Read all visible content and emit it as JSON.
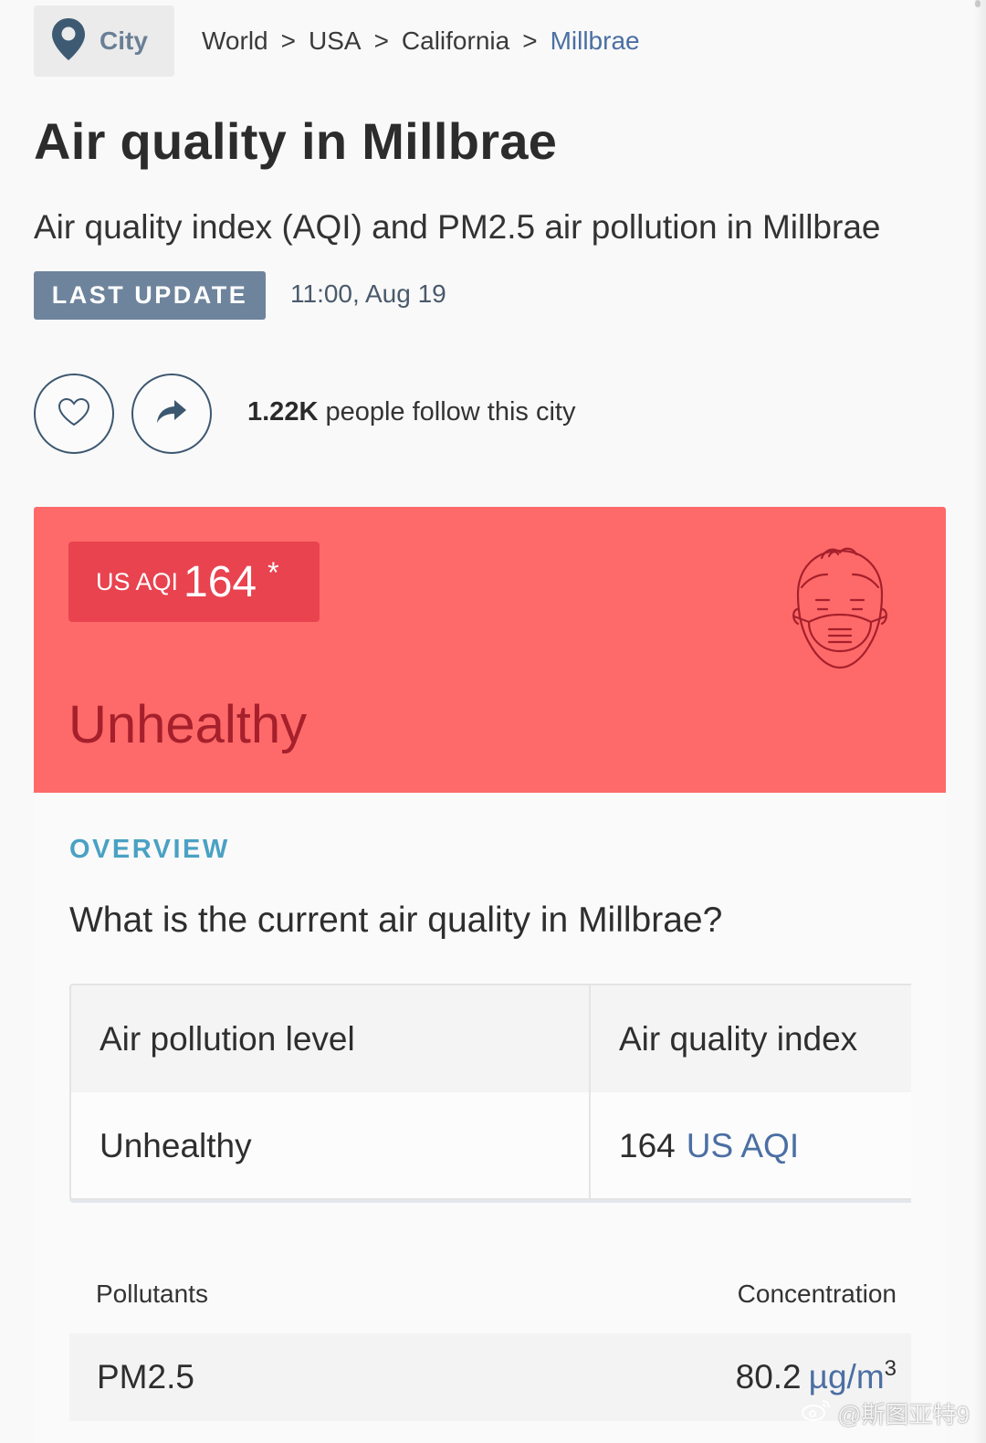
{
  "breadcrumb": {
    "tag_label": "City",
    "tag_icon": "map-pin-icon",
    "items": [
      "World",
      "USA",
      "California"
    ],
    "separator": ">",
    "current": "Millbrae"
  },
  "header": {
    "title": "Air quality in Millbrae",
    "subtitle": "Air quality index (AQI) and PM2.5 air pollution in Millbrae"
  },
  "update": {
    "badge_label": "LAST UPDATE",
    "time": "11:00, Aug 19"
  },
  "social": {
    "follow_count": "1.22K",
    "follow_text": "people follow this city",
    "like_icon": "heart-icon",
    "share_icon": "share-arrow-icon"
  },
  "aqi_card": {
    "label": "US AQI",
    "value": "164",
    "star": "*",
    "status": "Unhealthy",
    "background_color": "#fe6a69",
    "chip_color": "#e8434f",
    "status_color": "#a6202c",
    "icon": "face-mask-icon"
  },
  "overview": {
    "section_label": "OVERVIEW",
    "question": "What is the current air quality in Millbrae?",
    "table": {
      "headers": [
        "Air pollution level",
        "Air quality index"
      ],
      "level": "Unhealthy",
      "aqi_value": "164",
      "aqi_unit": "US AQI"
    }
  },
  "pollutants": {
    "col_pollutant": "Pollutants",
    "col_concentration": "Concentration",
    "rows": [
      {
        "name": "PM2.5",
        "value": "80.2",
        "unit": "µg/m",
        "unit_sup": "3"
      }
    ]
  },
  "watermark": {
    "text": "@斯图亚特9",
    "icon": "weibo-icon"
  }
}
